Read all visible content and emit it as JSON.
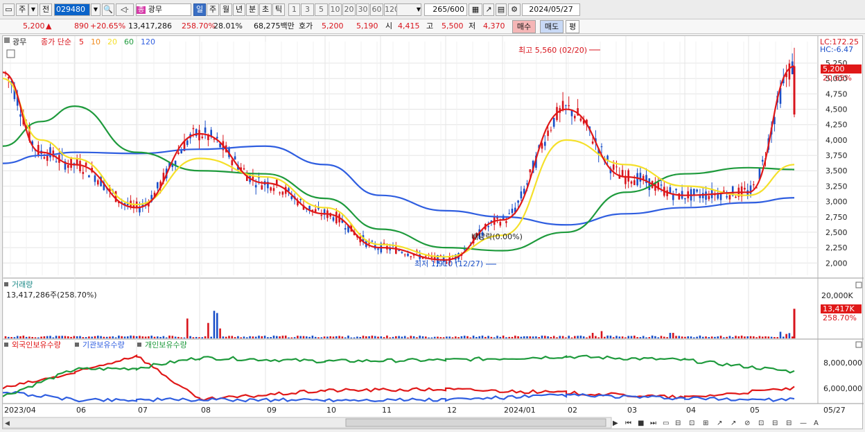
{
  "toolbar": {
    "mode_label": "주",
    "prefix_label": "전",
    "code": "029480",
    "name_badge": "종",
    "name": "광무",
    "periods": [
      "일",
      "주",
      "월",
      "년",
      "분",
      "초",
      "틱"
    ],
    "active_period": "일",
    "intervals": [
      "1",
      "3",
      "5",
      "10",
      "20",
      "30",
      "60",
      "120"
    ],
    "count": "265",
    "count_total": "/600",
    "date": "2024/05/27"
  },
  "quote": {
    "price": "5,200",
    "arrow": "▲",
    "change": "890",
    "change_pct": "+20.65%",
    "volume": "13,417,286",
    "vol_ratio": "258.70%",
    "turnover": "28.01%",
    "amount": "68,275백만",
    "ask_label": "호가",
    "ask": "5,200",
    "bid": "5,190",
    "open_label": "시",
    "open": "4,415",
    "high_label": "고",
    "high": "5,500",
    "low_label": "저",
    "low": "4,370",
    "buy_label": "매수",
    "sell_label": "매도",
    "exit_label": "평"
  },
  "price_panel": {
    "stock_name": "광무",
    "ma_title": "종가 단순",
    "ma_periods": [
      "5",
      "10",
      "20",
      "60",
      "120"
    ],
    "ma_colors": [
      "#e01818",
      "#f08a1c",
      "#f5e02a",
      "#1e9a3c",
      "#2f5ee0"
    ],
    "lc": "LC:172.25",
    "hc": "HC:-6.47",
    "current_price": "5,200",
    "current_pct": "20.65%",
    "high_note": "최고 5,560 (02/20)",
    "low_note": "최저 1,910 (12/27)",
    "dividend_note": "배당락(0.00%)",
    "y_ticks": [
      "5,250",
      "5,000",
      "4,750",
      "4,500",
      "4,250",
      "4,000",
      "3,750",
      "3,500",
      "3,250",
      "3,000",
      "2,750",
      "2,500",
      "2,250",
      "2,000"
    ]
  },
  "volume_panel": {
    "title": "거래량",
    "subtitle": "13,417,286주(258.70%)",
    "y_tick": "20,000K",
    "current": "13,417K",
    "current_pct": "258.70%"
  },
  "holding_panel": {
    "legend": [
      "외국인보유수량",
      "기관보유수량",
      "개인보유수량"
    ],
    "legend_colors": [
      "#e01818",
      "#2f5ee0",
      "#1e9a3c"
    ],
    "y_ticks": [
      "8,000,000",
      "6,000,000"
    ]
  },
  "x_axis": {
    "labels": [
      "2023/04",
      "06",
      "07",
      "08",
      "09",
      "10",
      "11",
      "12",
      "2024/01",
      "02",
      "03",
      "04",
      "05"
    ],
    "end_label": "05/27"
  },
  "chart_data": [
    {
      "type": "line",
      "title": "광무 종가 단순",
      "x": [
        "2023/04",
        "2023/05",
        "2023/06",
        "2023/07",
        "2023/08",
        "2023/09",
        "2023/10",
        "2023/11",
        "2023/12",
        "2024/01",
        "2024/02",
        "2024/03",
        "2024/04",
        "2024/05",
        "2024/05/27"
      ],
      "series": [
        {
          "name": "5",
          "values": [
            5100,
            3800,
            3600,
            2900,
            4100,
            3300,
            2800,
            2250,
            2050,
            2700,
            4500,
            3400,
            3100,
            3150,
            5200
          ]
        },
        {
          "name": "20",
          "values": [
            5000,
            4000,
            3700,
            2950,
            3700,
            3400,
            2900,
            2300,
            2100,
            2450,
            4000,
            3600,
            3250,
            3100,
            3600
          ]
        },
        {
          "name": "60",
          "values": [
            3900,
            4300,
            4550,
            3800,
            3500,
            3450,
            3050,
            2550,
            2250,
            2200,
            2500,
            3150,
            3450,
            3550,
            3520
          ]
        },
        {
          "name": "120",
          "values": [
            3620,
            3750,
            3800,
            3780,
            3850,
            3900,
            3600,
            3100,
            2850,
            2750,
            2620,
            2800,
            2900,
            2980,
            3060
          ]
        }
      ],
      "ylim": [
        1800,
        5600
      ],
      "annotations": [
        "최고 5,560 (02/20)",
        "최저 1,910 (12/27)",
        "배당락(0.00%)"
      ]
    },
    {
      "type": "bar",
      "title": "거래량",
      "x": [
        "2023/04",
        "2023/07",
        "2023/08",
        "2023/08b",
        "2024/02",
        "2024/03",
        "2024/05/27"
      ],
      "values": [
        700,
        1200,
        9000,
        12500,
        3500,
        2500,
        13417
      ],
      "ylim": [
        0,
        22000
      ]
    },
    {
      "type": "line",
      "title": "보유수량",
      "x": [
        "2023/04",
        "2023/06",
        "2023/07",
        "2023/08",
        "2023/10",
        "2023/12",
        "2024/02",
        "2024/04",
        "2024/05/27"
      ],
      "series": [
        {
          "name": "외국인보유수량",
          "values": [
            6200000,
            7500000,
            9000000,
            5200000,
            6000000,
            6100000,
            5800000,
            5400000,
            6200000
          ]
        },
        {
          "name": "기관보유수량",
          "values": [
            5900000,
            5200000,
            5200000,
            5200000,
            5200000,
            5200000,
            5600000,
            5300000,
            5200000
          ]
        },
        {
          "name": "개인보유수량",
          "values": [
            5500000,
            7800000,
            7900000,
            8800000,
            8500000,
            8600000,
            8900000,
            8600000,
            7600000
          ]
        }
      ],
      "ylim": [
        5000000,
        9500000
      ]
    }
  ]
}
